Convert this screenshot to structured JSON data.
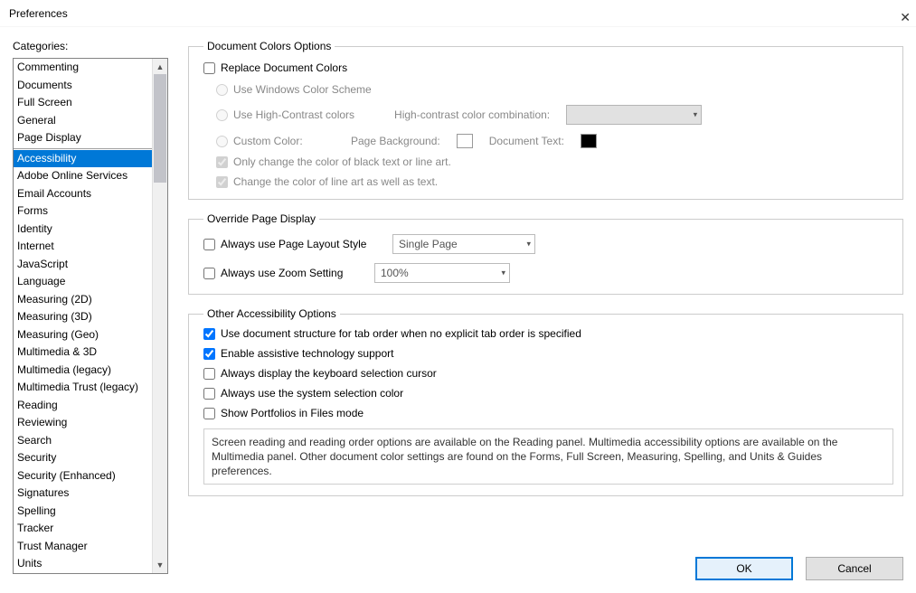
{
  "title": "Preferences",
  "categories_label": "Categories:",
  "categories_group1": [
    "Commenting",
    "Documents",
    "Full Screen",
    "General",
    "Page Display"
  ],
  "categories_group2": [
    "Accessibility",
    "Adobe Online Services",
    "Email Accounts",
    "Forms",
    "Identity",
    "Internet",
    "JavaScript",
    "Language",
    "Measuring (2D)",
    "Measuring (3D)",
    "Measuring (Geo)",
    "Multimedia & 3D",
    "Multimedia (legacy)",
    "Multimedia Trust (legacy)",
    "Reading",
    "Reviewing",
    "Search",
    "Security",
    "Security (Enhanced)",
    "Signatures",
    "Spelling",
    "Tracker",
    "Trust Manager",
    "Units"
  ],
  "selected_category": "Accessibility",
  "doc_colors": {
    "legend": "Document Colors Options",
    "replace": "Replace Document Colors",
    "use_windows": "Use Windows Color Scheme",
    "use_high_contrast": "Use High-Contrast colors",
    "high_contrast_combo_label": "High-contrast color combination:",
    "custom_color": "Custom Color:",
    "page_bg": "Page Background:",
    "doc_text": "Document Text:",
    "only_black": "Only change the color of black text or line art.",
    "change_lineart": "Change the color of line art as well as text."
  },
  "override": {
    "legend": "Override Page Display",
    "always_layout": "Always use Page Layout Style",
    "layout_value": "Single Page",
    "always_zoom": "Always use Zoom Setting",
    "zoom_value": "100%"
  },
  "other": {
    "legend": "Other Accessibility Options",
    "use_doc_structure": "Use document structure for tab order when no explicit tab order is specified",
    "enable_assistive": "Enable assistive technology support",
    "always_kb_cursor": "Always display the keyboard selection cursor",
    "always_sys_sel": "Always use the system selection color",
    "show_portfolios": "Show Portfolios in Files mode",
    "info": "Screen reading and reading order options are available on the Reading panel. Multimedia accessibility options are available on the Multimedia panel. Other document color settings are found on the Forms, Full Screen, Measuring, Spelling, and Units & Guides preferences."
  },
  "buttons": {
    "ok": "OK",
    "cancel": "Cancel"
  }
}
